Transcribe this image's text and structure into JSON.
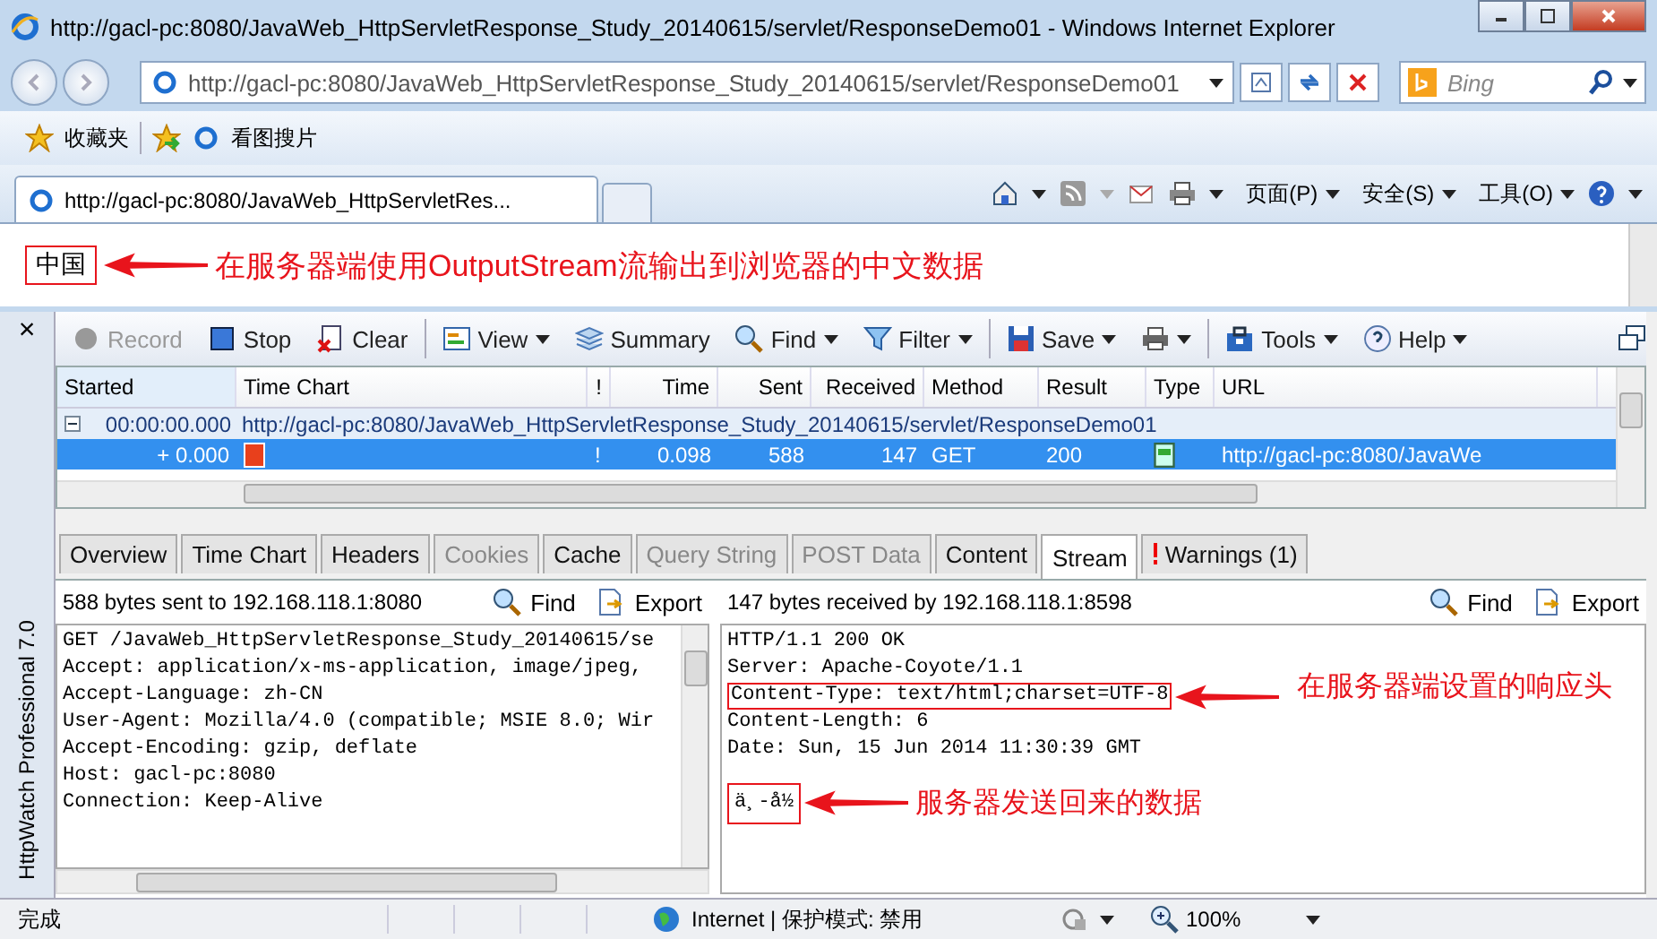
{
  "window": {
    "title": "http://gacl-pc:8080/JavaWeb_HttpServletResponse_Study_20140615/servlet/ResponseDemo01 - Windows Internet Explorer"
  },
  "nav": {
    "address": "http://gacl-pc:8080/JavaWeb_HttpServletResponse_Study_20140615/servlet/ResponseDemo01",
    "search_placeholder": "Bing"
  },
  "favorites": {
    "label": "收藏夹",
    "items": [
      "看图搜片"
    ]
  },
  "tabs": [
    {
      "label": "http://gacl-pc:8080/JavaWeb_HttpServletRes...",
      "selected": true
    }
  ],
  "command_bar": [
    "页面(P)",
    "安全(S)",
    "工具(O)"
  ],
  "page": {
    "text": "中国",
    "annotation": "在服务器端使用OutputStream流输出到浏览器的中文数据"
  },
  "httpwatch": {
    "title": "HttpWatch Professional 7.0",
    "close": "×",
    "toolbar": [
      {
        "kind": "record",
        "label": "Record",
        "dropdown": false,
        "disabled": true
      },
      {
        "kind": "stop",
        "label": "Stop",
        "dropdown": false,
        "disabled": false
      },
      {
        "kind": "clear",
        "label": "Clear",
        "dropdown": false,
        "disabled": false
      },
      {
        "kind": "view",
        "label": "View",
        "dropdown": true,
        "disabled": false
      },
      {
        "kind": "summary",
        "label": "Summary",
        "dropdown": false,
        "disabled": false
      },
      {
        "kind": "find",
        "label": "Find",
        "dropdown": true,
        "disabled": false
      },
      {
        "kind": "filter",
        "label": "Filter",
        "dropdown": true,
        "disabled": false
      },
      {
        "kind": "save",
        "label": "Save",
        "dropdown": true,
        "disabled": false
      },
      {
        "kind": "print",
        "dropdown": true,
        "disabled": false
      },
      {
        "kind": "tools",
        "label": "Tools",
        "dropdown": true,
        "disabled": false
      },
      {
        "kind": "help",
        "label": "Help",
        "dropdown": true,
        "disabled": false
      }
    ],
    "columns": [
      "Started",
      "Time Chart",
      "!",
      "Time",
      "Sent",
      "Received",
      "Method",
      "Result",
      "Type",
      "URL"
    ],
    "group": {
      "started": "00:00:00.000",
      "url": "http://gacl-pc:8080/JavaWeb_HttpServletResponse_Study_20140615/servlet/ResponseDemo01",
      "expanded": true
    },
    "rows": [
      {
        "started": "+ 0.000",
        "warning": "!",
        "time": "0.098",
        "sent": "588",
        "received": "147",
        "method": "GET",
        "result": "200",
        "url": "http://gacl-pc:8080/JavaWe",
        "selected": true
      }
    ],
    "detail_tabs": [
      {
        "label": "Overview",
        "selected": false,
        "disabled": false,
        "warning": false
      },
      {
        "label": "Time Chart",
        "selected": false,
        "disabled": false,
        "warning": false
      },
      {
        "label": "Headers",
        "selected": false,
        "disabled": false,
        "warning": false
      },
      {
        "label": "Cookies",
        "selected": false,
        "disabled": true,
        "warning": false
      },
      {
        "label": "Cache",
        "selected": false,
        "disabled": false,
        "warning": false
      },
      {
        "label": "Query String",
        "selected": false,
        "disabled": true,
        "warning": false
      },
      {
        "label": "POST Data",
        "selected": false,
        "disabled": true,
        "warning": false
      },
      {
        "label": "Content",
        "selected": false,
        "disabled": false,
        "warning": false
      },
      {
        "label": "Stream",
        "selected": true,
        "disabled": false,
        "warning": false
      },
      {
        "label": "Warnings (1)",
        "selected": false,
        "disabled": false,
        "warning": true
      }
    ],
    "request": {
      "summary": "588 bytes sent to 192.168.118.1:8080",
      "find": "Find",
      "export": "Export",
      "lines": [
        "GET /JavaWeb_HttpServletResponse_Study_20140615/se",
        "Accept: application/x-ms-application, image/jpeg,",
        "Accept-Language: zh-CN",
        "User-Agent: Mozilla/4.0 (compatible; MSIE 8.0; Wir",
        "Accept-Encoding: gzip, deflate",
        "Host: gacl-pc:8080",
        "Connection: Keep-Alive"
      ]
    },
    "response": {
      "summary": "147 bytes received by 192.168.118.1:8598",
      "find": "Find",
      "export": "Export",
      "lines": [
        {
          "text": "HTTP/1.1 200 OK",
          "highlighted": false
        },
        {
          "text": "Server: Apache-Coyote/1.1",
          "highlighted": false
        },
        {
          "text": "Content-Type: text/html;charset=UTF-8",
          "highlighted": true,
          "note": "在服务器端设置的响应头"
        },
        {
          "text": "Content-Length: 6",
          "highlighted": false
        },
        {
          "text": "Date: Sun, 15 Jun 2014 11:30:39 GMT",
          "highlighted": false
        }
      ],
      "body": {
        "text": "ä¸-å½",
        "highlighted": true,
        "note": "服务器发送回来的数据"
      }
    }
  },
  "status_bar": {
    "text": "完成",
    "zone": "Internet | 保护模式: 禁用",
    "zoom": "100%"
  }
}
